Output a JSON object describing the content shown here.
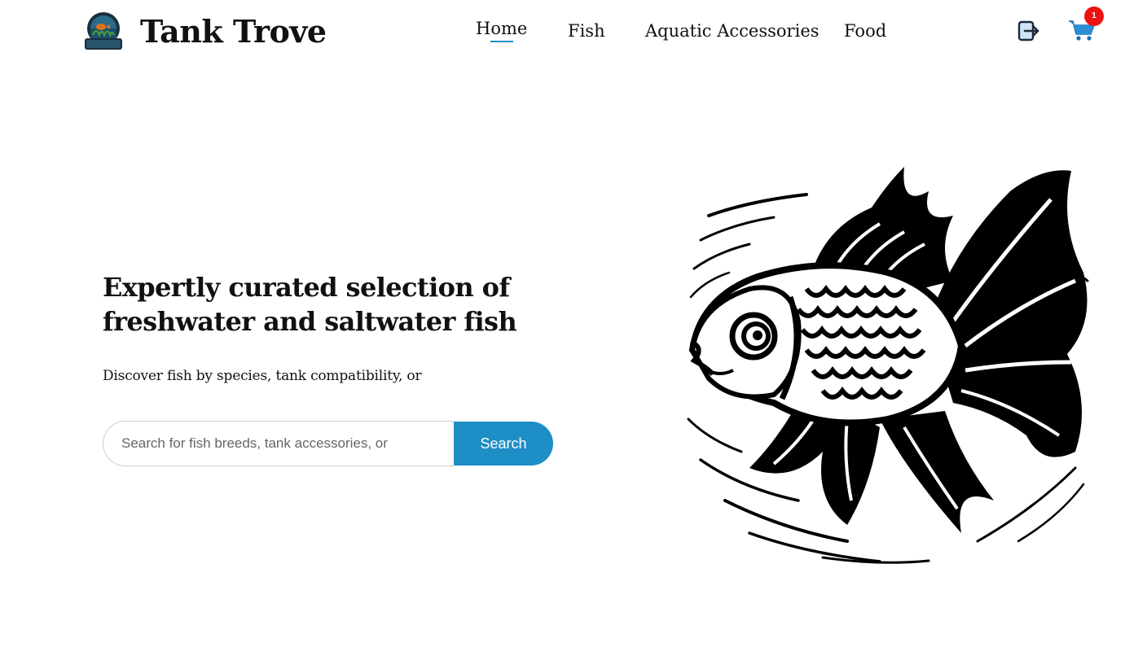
{
  "header": {
    "logo_text": "TANK TROVE",
    "brand": "Tank Trove",
    "nav": [
      {
        "label": "Home",
        "active": true
      },
      {
        "label": "Fish",
        "active": false
      },
      {
        "label": "Aquatic Accessories",
        "active": false
      },
      {
        "label": "Food",
        "active": false
      }
    ],
    "icons": {
      "login": "login-icon",
      "cart": "cart-icon"
    },
    "cart_count": "1"
  },
  "hero": {
    "title": "Expertly curated selection of freshwater and saltwater fish",
    "subtitle": "Discover fish by species, tank compatibility, or",
    "search_placeholder": "Search for fish breeds, tank accessories, or",
    "search_button": "Search",
    "image_icon": "goldfish-illustration"
  },
  "colors": {
    "accent": "#1e8ec6",
    "badge": "#ee1111",
    "text": "#111111",
    "background": "#ffffff"
  }
}
